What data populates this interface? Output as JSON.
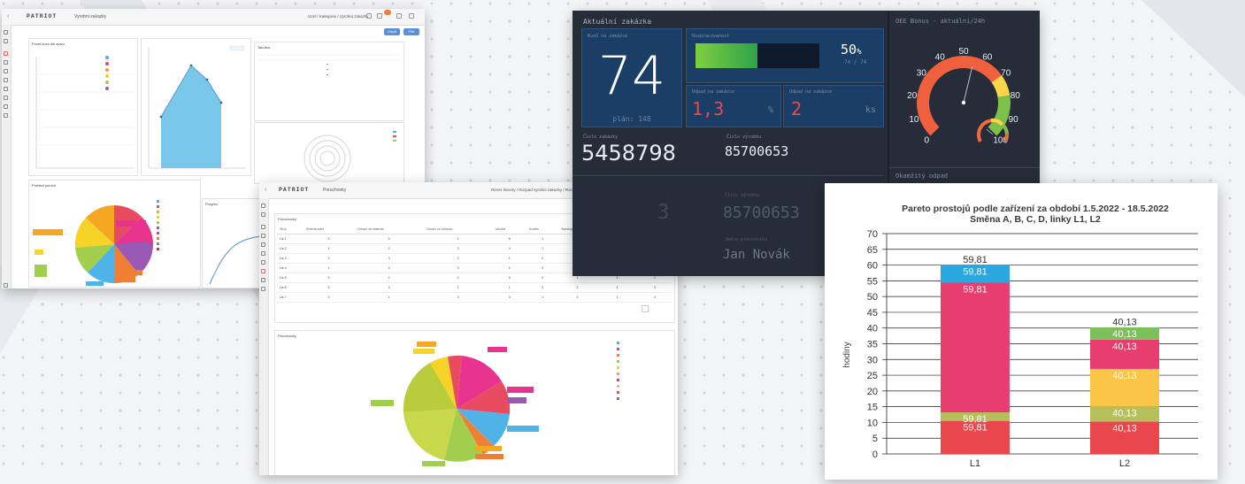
{
  "window1": {
    "logo": "PATRIOT",
    "title": "Vyrobni zakazky",
    "breadcrumb": "Uzel / Kategorie / Vyrobni zakazky",
    "btn_primary": "Ulozit",
    "btn_secondary": "Filtr",
    "panel_legend_title": "Pocet kusu dle stavu",
    "panel_table_title": "Tabulka",
    "panel_pie_title": "Prehled poruch",
    "panel_prog_title": "Progres"
  },
  "window2": {
    "logo": "PATRIOT",
    "title": "Poruchovky",
    "breadcrumb": "Rizeni lisovny / Rozpad vyrobni zakazky / Rozpad / Poruchovky",
    "btn_primary": "Ulozit",
    "btn_secondary": "Filtr",
    "table_title": "Poruchovky",
    "table_headers": [
      "Stroj",
      "Seserizovani",
      "Cekani na material",
      "Cekani na obsluhu",
      "Udrzba",
      "Kvalita",
      "Nastroje",
      "Planovani",
      "Ostatni"
    ],
    "table_rows": [
      [
        "Lis 1",
        "3",
        "5",
        "1",
        "6",
        "1",
        "1",
        "3",
        "1"
      ],
      [
        "Lis 2",
        "1",
        "2",
        "3",
        "4",
        "1",
        "2",
        "3",
        "3"
      ],
      [
        "Lis 3",
        "3",
        "3",
        "2",
        "1",
        "2",
        "1",
        "3",
        "1"
      ],
      [
        "Lis 4",
        "1",
        "3",
        "3",
        "2",
        "3",
        "3",
        "1",
        "3"
      ],
      [
        "Lis 5",
        "3",
        "2",
        "2",
        "5",
        "2",
        "1",
        "3",
        "1"
      ],
      [
        "Lis 6",
        "3",
        "3",
        "1",
        "1",
        "3",
        "2",
        "3",
        "3"
      ],
      [
        "Lis 7",
        "2",
        "1",
        "3",
        "3",
        "1",
        "2",
        "1",
        "3"
      ]
    ],
    "pie_title": "Poruchovky"
  },
  "dashboard": {
    "current_order_title": "Aktuální zakázka",
    "pieces_label": "Kusů na zakázce",
    "pieces_value": "74",
    "plan_label": "plán: 148",
    "progress_label": "Rozpracovanost",
    "progress_value": 50,
    "progress_suffix": "%",
    "progress_sub": "74 / 74",
    "reject_pct_label": "Odpad na zakázce",
    "reject_pct_value": "1,3",
    "reject_pct_unit": "%",
    "reject_count_label": "Odpad na zakázce",
    "reject_count_value": "2",
    "reject_count_unit": "ks",
    "order_no_label": "Číslo zakázky",
    "order_no_value": "5458798",
    "item_no_label": "Číslo výrobku",
    "item_no_value": "85700653",
    "item_no_value_2": "85700653",
    "operator_label": "Jméno pracovníka",
    "operator_value": "Jan Novák",
    "oee_title": "OEE Bonus - aktuální/24h",
    "oee_value": 55,
    "gauge_ticks": [
      "0",
      "10",
      "20",
      "30",
      "40",
      "50",
      "60",
      "70",
      "80",
      "90",
      "100"
    ],
    "instant_waste_title": "Okamžitý odpad"
  },
  "chart_data": {
    "type": "bar",
    "stacked": true,
    "title": "Pareto prostojů podle zařízení za období 1.5.2022 - 18.5.2022",
    "subtitle": "Směna A, B, C, D, linky L1, L2",
    "xlabel": "",
    "ylabel": "hodiny",
    "categories": [
      "L1",
      "L2"
    ],
    "ylim": [
      0,
      70
    ],
    "yticks": [
      0,
      5,
      10,
      15,
      20,
      25,
      30,
      35,
      40,
      45,
      50,
      55,
      60,
      65,
      70
    ],
    "grid": true,
    "totals": [
      59.81,
      40.13
    ],
    "total_labels": [
      "59,81",
      "40,13"
    ],
    "series": [
      {
        "color": "#e9474d",
        "values": [
          10.5,
          10.3
        ],
        "labels": [
          "59,81",
          "40,13"
        ]
      },
      {
        "color": "#b7bf5a",
        "values": [
          2.7,
          4.7
        ],
        "labels": [
          "59,81",
          "40,13"
        ]
      },
      {
        "color": "#fbc548",
        "values": [
          0,
          12.0
        ],
        "labels": [
          "",
          "40,13"
        ]
      },
      {
        "color": "#e83e6f",
        "values": [
          41.2,
          9.3
        ],
        "labels": [
          "59,81",
          "40,13"
        ]
      },
      {
        "color": "#2aa7de",
        "values": [
          5.6,
          0
        ],
        "labels": [
          "59,81",
          ""
        ]
      },
      {
        "color": "#7cc05c",
        "values": [
          0,
          3.9
        ],
        "labels": [
          "",
          "40,13"
        ]
      }
    ]
  }
}
